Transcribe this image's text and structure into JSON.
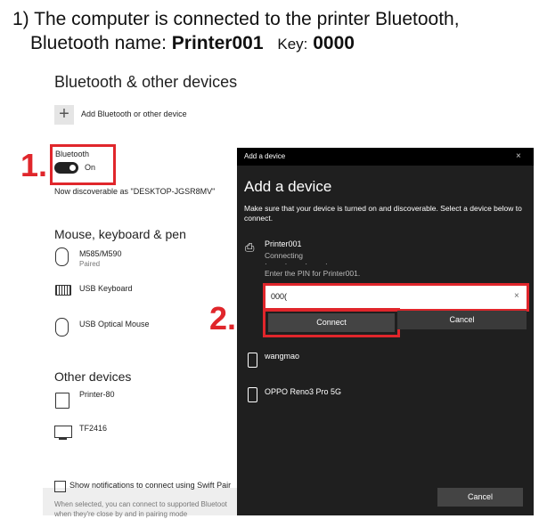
{
  "instruction": {
    "prefix": "1) The computer is connected to the printer Bluetooth,",
    "line2_prefix": "Bluetooth name:",
    "bt_name": "Printer001",
    "key_label": "Key:",
    "key": "0000"
  },
  "settings": {
    "title": "Bluetooth & other devices",
    "add_device_label": "Add Bluetooth or other device",
    "bluetooth_label": "Bluetooth",
    "toggle_state": "On",
    "discoverable_text": "Now discoverable as \"DESKTOP-JGSR8MV\"",
    "mouse_section": "Mouse, keyboard & pen",
    "mouse_devices": [
      {
        "name": "M585/M590",
        "status": "Paired"
      },
      {
        "name": "USB Keyboard",
        "status": ""
      },
      {
        "name": "USB Optical Mouse",
        "status": ""
      }
    ],
    "other_section": "Other devices",
    "other_devices": [
      {
        "name": "Printer-80"
      },
      {
        "name": "TF2416"
      }
    ],
    "swift_pair_label": "Show notifications to connect using Swift Pair",
    "swift_pair_desc": "When selected, you can connect to supported Bluetoot when they're close by and in pairing mode"
  },
  "dialog": {
    "titlebar": "Add a device",
    "close_icon": "×",
    "heading": "Add a device",
    "intro": "Make sure that your device is turned on and discoverable. Select a device below to connect.",
    "device_name": "Printer001",
    "device_status": "Connecting",
    "pin_prompt": "Enter the PIN for Printer001.",
    "pin_value": "000(",
    "pin_clear": "×",
    "connect_label": "Connect",
    "cancel_label": "Cancel",
    "list": [
      {
        "name": "wangmao"
      },
      {
        "name": "OPPO Reno3 Pro 5G"
      }
    ],
    "footer_cancel": "Cancel"
  },
  "markers": {
    "step1": "1.",
    "step2": "2."
  },
  "colors": {
    "highlight": "#e0262b",
    "dialog_bg": "#1f1f1f",
    "button_bg": "#444444"
  }
}
